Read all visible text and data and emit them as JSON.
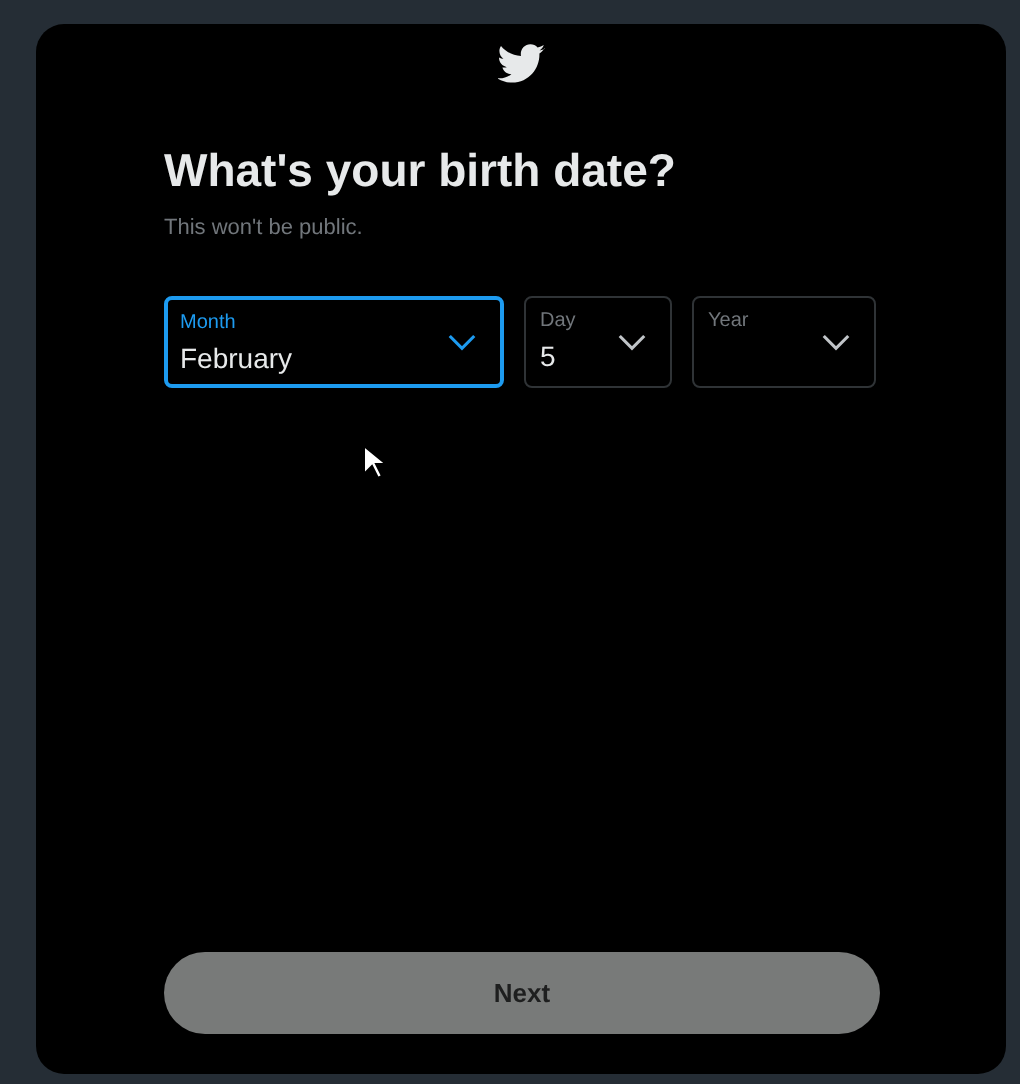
{
  "title": "What's your birth date?",
  "subtitle": "This won't be public.",
  "fields": [
    {
      "label": "Month",
      "value": "February",
      "focused": true
    },
    {
      "label": "Day",
      "value": "5",
      "focused": false
    },
    {
      "label": "Year",
      "focused": false
    }
  ],
  "next_button": {
    "label": "Next",
    "disabled": true
  }
}
